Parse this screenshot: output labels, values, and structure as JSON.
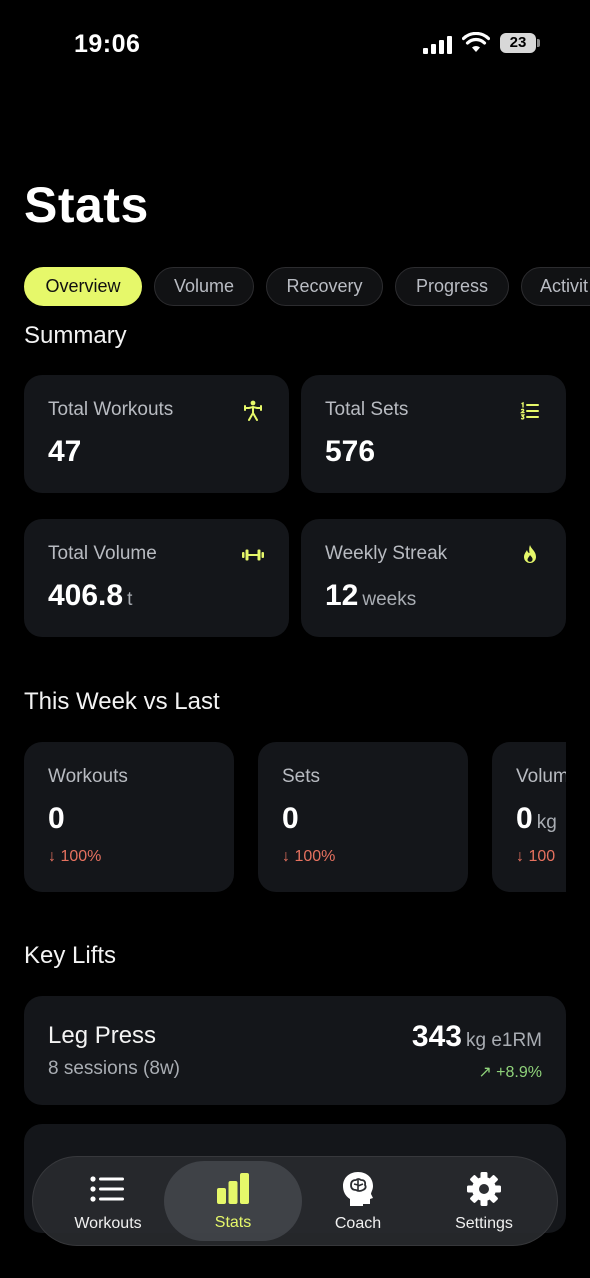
{
  "status": {
    "time": "19:06",
    "battery": "23"
  },
  "page_title": "Stats",
  "tabs": [
    "Overview",
    "Volume",
    "Recovery",
    "Progress",
    "Activit"
  ],
  "summary": {
    "title": "Summary",
    "cards": [
      {
        "label": "Total Workouts",
        "value": "47",
        "unit": "",
        "icon": "strength-figure-icon"
      },
      {
        "label": "Total Sets",
        "value": "576",
        "unit": "",
        "icon": "numbered-list-icon"
      },
      {
        "label": "Total Volume",
        "value": "406.8",
        "unit": "t",
        "icon": "dumbbell-icon"
      },
      {
        "label": "Weekly Streak",
        "value": "12",
        "unit": "weeks",
        "icon": "flame-icon"
      }
    ]
  },
  "week_compare": {
    "title": "This Week vs Last",
    "cards": [
      {
        "label": "Workouts",
        "value": "0",
        "unit": "",
        "delta": "↓ 100%"
      },
      {
        "label": "Sets",
        "value": "0",
        "unit": "",
        "delta": "↓ 100%"
      },
      {
        "label": "Volum",
        "value": "0",
        "unit": "kg",
        "delta": "↓ 100"
      }
    ]
  },
  "key_lifts": {
    "title": "Key Lifts",
    "items": [
      {
        "name": "Leg Press",
        "sessions": "8 sessions (8w)",
        "value": "343",
        "unit": "kg e1RM",
        "change": "↗ +8.9%"
      }
    ]
  },
  "nav": {
    "items": [
      {
        "label": "Workouts",
        "icon": "list-icon"
      },
      {
        "label": "Stats",
        "icon": "bar-chart-icon"
      },
      {
        "label": "Coach",
        "icon": "brain-head-icon"
      },
      {
        "label": "Settings",
        "icon": "gear-icon"
      }
    ]
  },
  "colors": {
    "accent": "#e6f86a",
    "negative": "#e5715f",
    "positive": "#8fd27a",
    "card": "#14161a"
  }
}
